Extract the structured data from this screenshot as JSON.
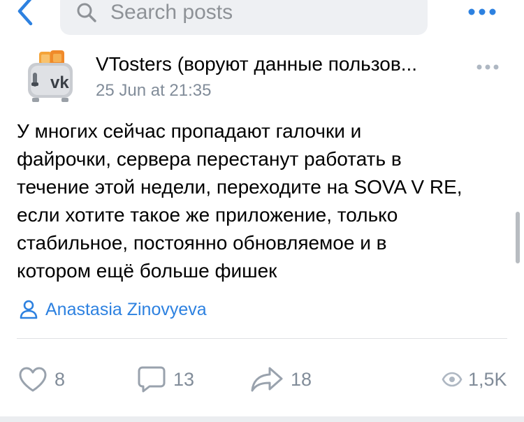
{
  "search": {
    "placeholder": "Search posts"
  },
  "post": {
    "author": "VTosters (воруют данные пользов...",
    "time": "25 Jun at 21:35",
    "text_lines": [
      "У многих сейчас пропадают галочки и",
      "файрочки, сервера перестанут работать в",
      "течение этой недели, переходите на SOVA V RE,",
      "если хотите такое же приложение, только",
      "стабильное, постоянно обновляемое и в",
      "котором ещё больше фишек"
    ],
    "signer": "Anastasia Zinovyeva",
    "likes": "8",
    "comments": "13",
    "shares": "18",
    "views": "1,5K"
  },
  "colors": {
    "accent": "#2d81e0",
    "secondary_text": "#818c99",
    "search_bg": "#eef0f3",
    "divider": "#dfe1e4"
  },
  "icons": {
    "back": "chevron-left-icon",
    "search": "search-icon",
    "more": "more-horizontal-icon",
    "signer": "user-icon",
    "like": "heart-icon",
    "comment": "comment-icon",
    "share": "share-arrow-icon",
    "views": "eye-icon"
  }
}
